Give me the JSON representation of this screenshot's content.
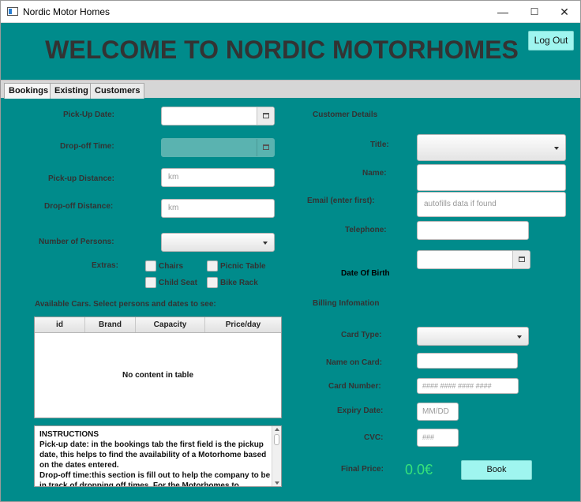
{
  "window": {
    "title": "Nordic Motor Homes",
    "minimize": "—",
    "maximize": "☐",
    "close": "✕"
  },
  "header": {
    "headline": "WELCOME TO NORDIC MOTORHOMES",
    "logout_label": "Log Out"
  },
  "tabs": [
    {
      "label": "Bookings",
      "active": true
    },
    {
      "label": "Existing"
    },
    {
      "label": "Customers"
    }
  ],
  "booking": {
    "pickup_date_label": "Pick-Up Date:",
    "dropoff_time_label": "Drop-off Time:",
    "pickup_distance_label": "Pick-up Distance:",
    "pickup_distance_placeholder": "km",
    "dropoff_distance_label": "Drop-off Distance:",
    "dropoff_distance_placeholder": "km",
    "persons_label": "Number of Persons:",
    "extras_label": "Extras:",
    "extras": [
      {
        "label": "Chairs",
        "checked": false
      },
      {
        "label": "Picnic Table",
        "checked": false
      },
      {
        "label": "Child Seat",
        "checked": false
      },
      {
        "label": "Bike Rack",
        "checked": false
      }
    ],
    "available_cars_label": "Available Cars. Select persons and dates to see:",
    "table": {
      "columns": [
        "id",
        "Brand",
        "Capacity",
        "Price/day"
      ],
      "empty_text": "No content in table"
    },
    "instructions": "INSTRUCTIONS\nPick-up date: in the bookings tab the first field is the pickup date, this helps to find the availability of a Motorhome based on the dates entered.\nDrop-off time:this section is fill out to help the company to be in track of dropping off times. For the Motorhomes to"
  },
  "customer": {
    "section_label": "Customer Details",
    "title_label": "Title:",
    "name_label": "Name:",
    "email_label": "Email (enter first):",
    "email_placeholder": "autofills data if found",
    "telephone_label": "Telephone:",
    "dob_label": "Date Of Birth"
  },
  "billing": {
    "section_label": "Billing Infomation",
    "card_type_label": "Card Type:",
    "name_on_card_label": "Name on Card:",
    "card_number_label": "Card Number:",
    "card_number_placeholder": "#### #### #### ####",
    "expiry_label": "Expiry Date:",
    "expiry_placeholder": "MM/DD",
    "cvc_label": "CVC:",
    "cvc_placeholder": "###",
    "final_price_label": "Final Price:",
    "final_price_value": "0.0€",
    "book_label": "Book"
  },
  "colors": {
    "background": "#008b8b",
    "accent_button": "#9ff5ef",
    "price": "#37e27a"
  }
}
